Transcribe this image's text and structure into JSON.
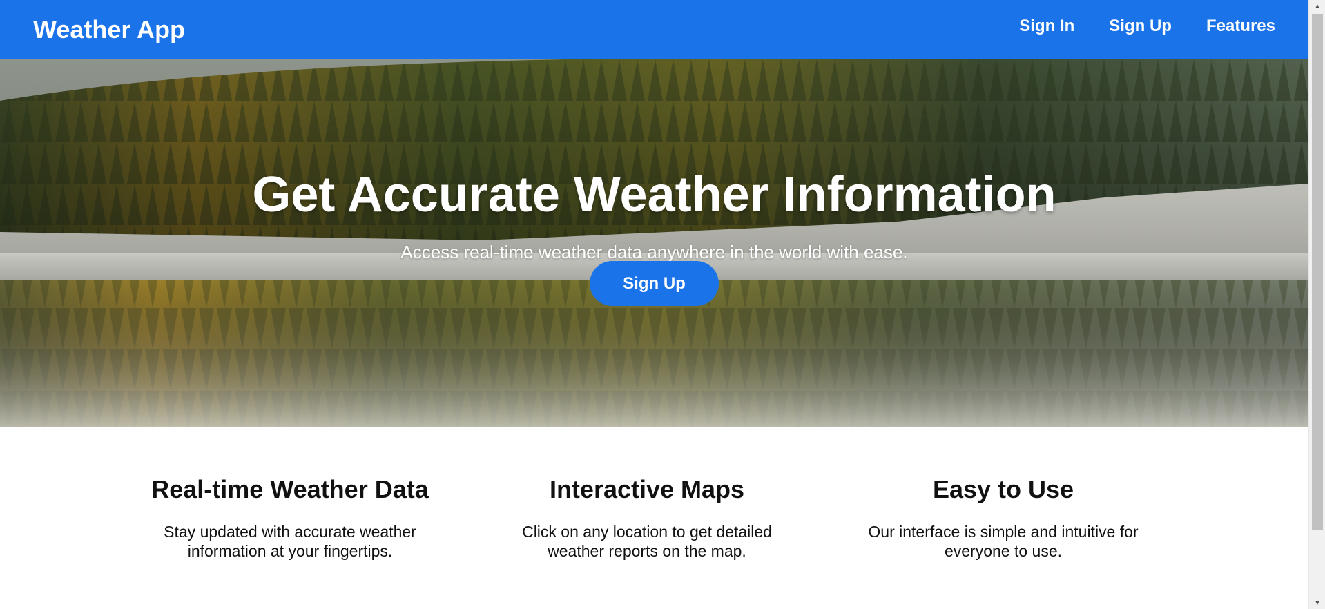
{
  "header": {
    "brand": "Weather App",
    "nav": [
      {
        "label": "Sign In"
      },
      {
        "label": "Sign Up"
      },
      {
        "label": "Features"
      }
    ]
  },
  "hero": {
    "title": "Get Accurate Weather Information",
    "subtitle": "Access real-time weather data anywhere in the world with ease.",
    "cta_label": "Sign Up"
  },
  "features": [
    {
      "title": "Real-time Weather Data",
      "text": "Stay updated with accurate weather information at your fingertips."
    },
    {
      "title": "Interactive Maps",
      "text": "Click on any location to get detailed weather reports on the map."
    },
    {
      "title": "Easy to Use",
      "text": "Our interface is simple and intuitive for everyone to use."
    }
  ],
  "colors": {
    "primary": "#1a73e8",
    "text": "#111111",
    "background": "#ffffff"
  }
}
